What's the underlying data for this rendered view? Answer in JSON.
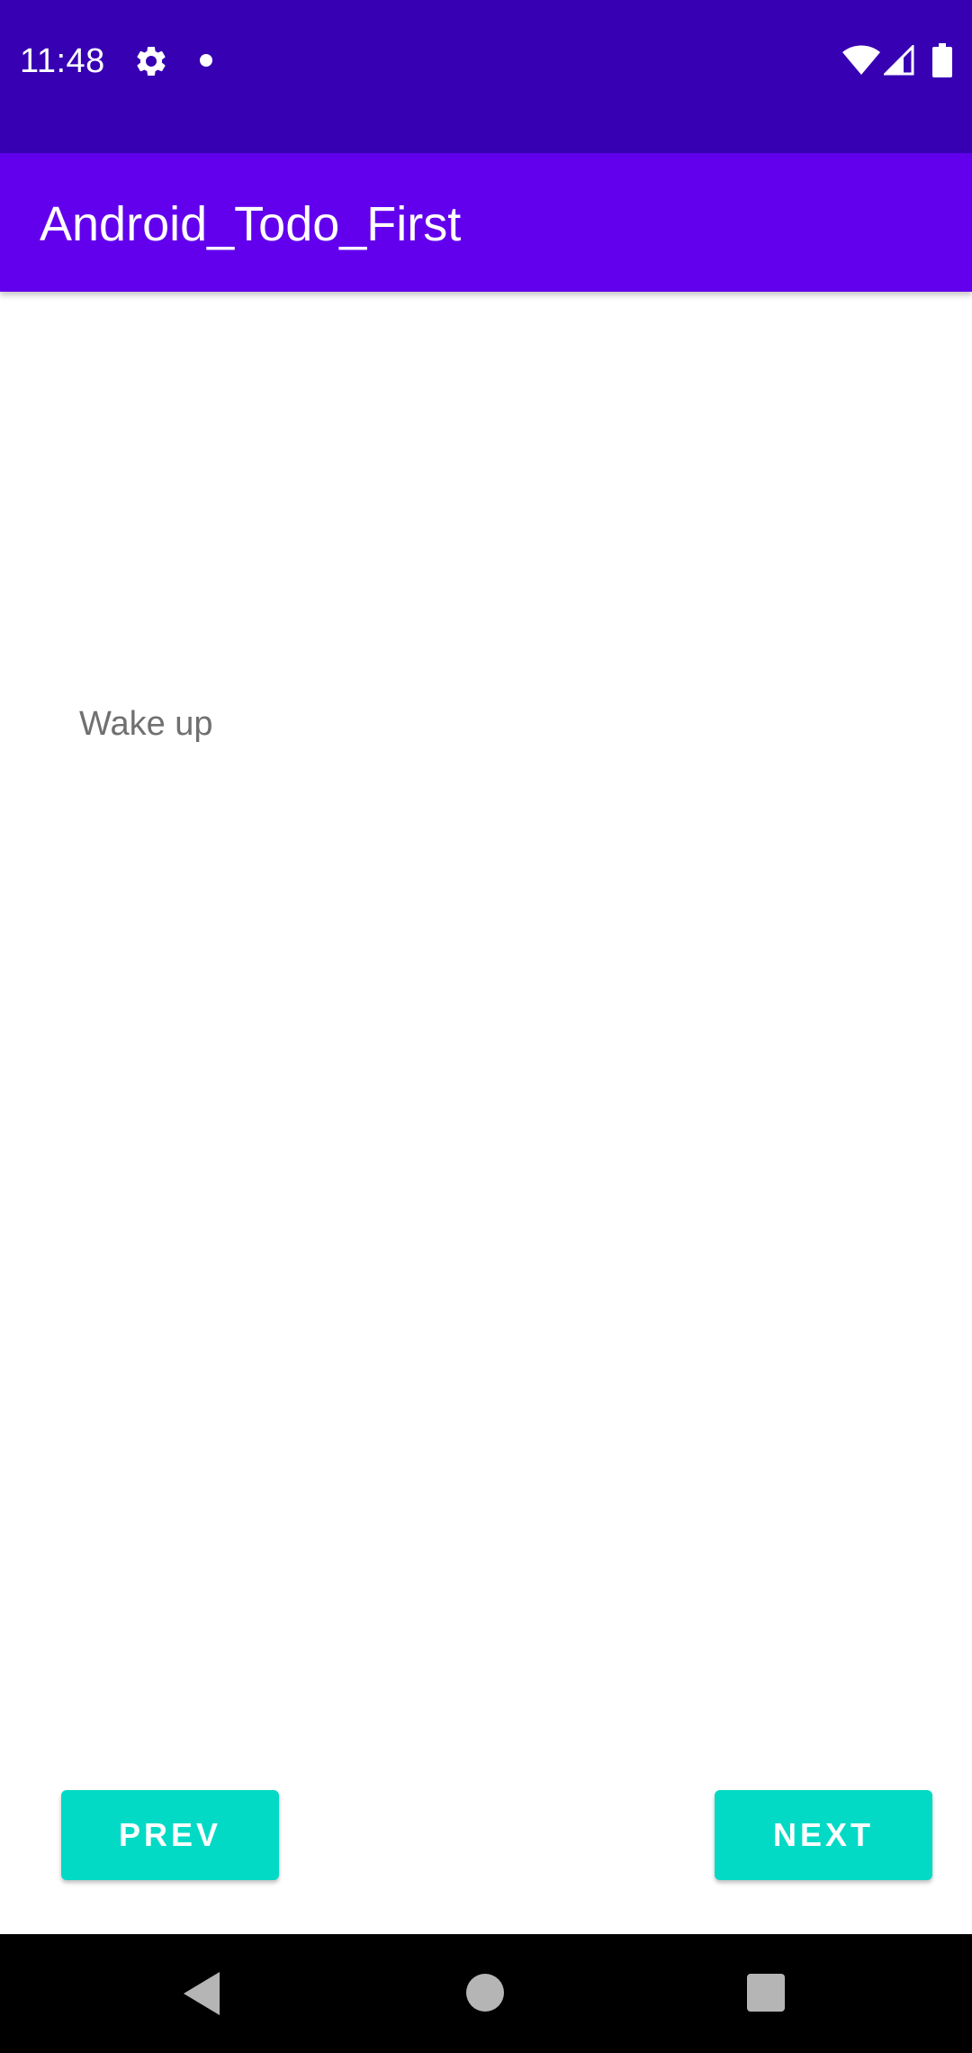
{
  "status_bar": {
    "time": "11:48",
    "icons": [
      "gear-icon",
      "notification-dot-icon",
      "wifi-icon",
      "signal-icon",
      "battery-icon"
    ],
    "background_color": "#3700B3"
  },
  "app_bar": {
    "title": "Android_Todo_First",
    "background_color": "#6200EE"
  },
  "main": {
    "todo_text": "Wake up"
  },
  "buttons": {
    "prev_label": "PREV",
    "next_label": "NEXT",
    "accent_color": "#03DAC5"
  },
  "nav_bar": {
    "icons": [
      "back-icon",
      "home-icon",
      "recents-icon"
    ]
  }
}
